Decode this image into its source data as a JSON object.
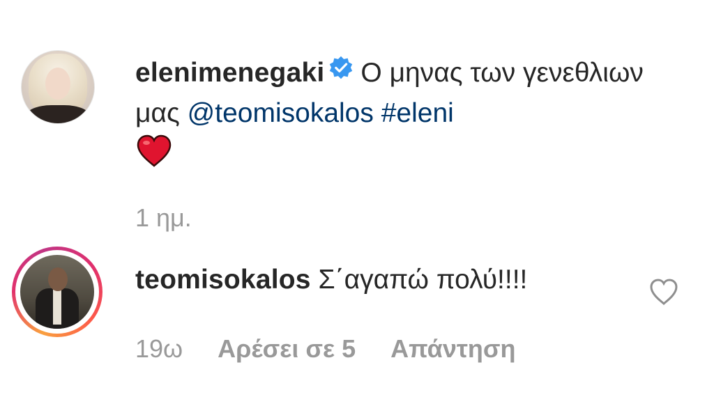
{
  "comments": [
    {
      "username": "elenimenegaki",
      "verified": true,
      "text": "Ο μηνας των γενεθλιων μας",
      "mention": "@teomisokalos",
      "hashtag": "#eleni",
      "emoji": "red-heart-emoji",
      "timestamp": "1 ημ."
    },
    {
      "username": "teomisokalos",
      "text": "Σ΄αγαπώ πολύ!!!!",
      "timestamp": "19ω",
      "likes_label": "Αρέσει σε 5",
      "reply_label": "Απάντηση"
    }
  ],
  "colors": {
    "text": "#262626",
    "link": "#003569",
    "meta": "#999999",
    "verified": "#3897f0",
    "heart": "#e0142f"
  }
}
